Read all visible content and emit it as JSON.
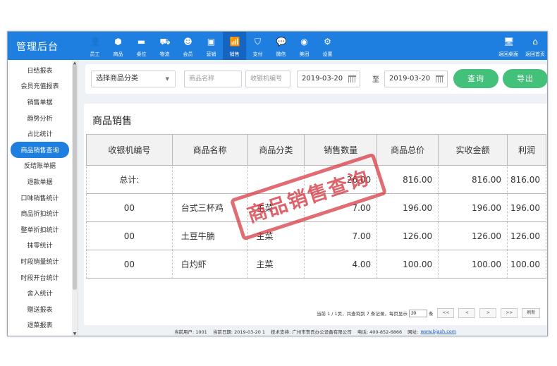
{
  "app": {
    "title": "管理后台"
  },
  "nav": {
    "items": [
      {
        "label": "员工",
        "icon": "user-icon",
        "glyph": "👤"
      },
      {
        "label": "商品",
        "icon": "cube-icon",
        "glyph": "⬢"
      },
      {
        "label": "桌位",
        "icon": "table-icon",
        "glyph": "▬"
      },
      {
        "label": "物流",
        "icon": "truck-icon",
        "glyph": "⛟"
      },
      {
        "label": "会员",
        "icon": "member-icon",
        "glyph": "☻"
      },
      {
        "label": "营销",
        "icon": "marketing-icon",
        "glyph": "▣"
      },
      {
        "label": "销售",
        "icon": "sales-chart-icon",
        "glyph": "📶"
      },
      {
        "label": "支付",
        "icon": "shield-pay-icon",
        "glyph": "⛉"
      },
      {
        "label": "微信",
        "icon": "wechat-icon",
        "glyph": "💬"
      },
      {
        "label": "美团",
        "icon": "meituan-icon",
        "glyph": "◉"
      },
      {
        "label": "设置",
        "icon": "gear-icon",
        "glyph": "⚙"
      }
    ],
    "active_index": 6,
    "right": [
      {
        "label": "返回桌面",
        "icon": "monitor-icon",
        "glyph": "🖥"
      },
      {
        "label": "返回首页",
        "icon": "home-icon",
        "glyph": "⌂"
      }
    ]
  },
  "sidebar": {
    "items": [
      "日结报表",
      "会员充值报表",
      "销售单据",
      "趋势分析",
      "占比统计",
      "商品销售查询",
      "反结账单据",
      "退款单据",
      "口味销售统计",
      "商品折扣统计",
      "整单折扣统计",
      "抹零统计",
      "时段销量统计",
      "时段开台统计",
      "舍入统计",
      "赠送报表",
      "退菜报表"
    ],
    "active_index": 5
  },
  "filter": {
    "category_select": "选择商品分类",
    "product_name_placeholder": "商品名称",
    "cashier_placeholder": "收银机编号",
    "date_from": "2019-03-20",
    "date_to": "2019-03-20",
    "to_label": "至",
    "query_label": "查询",
    "export_label": "导出"
  },
  "report": {
    "title": "商品销售",
    "columns": [
      "收银机编号",
      "商品名称",
      "商品分类",
      "销售数量",
      "商品总价",
      "实收金额",
      "利润"
    ],
    "total": {
      "label": "总计:",
      "qty": "26.00",
      "total_price": "816.00",
      "received": "816.00",
      "profit": "816.00"
    },
    "rows": [
      {
        "cashier": "00",
        "name": "台式三杯鸡",
        "category": "主菜",
        "qty": "7.00",
        "total_price": "196.00",
        "received": "196.00",
        "profit": "196.00"
      },
      {
        "cashier": "00",
        "name": "土豆牛腩",
        "category": "主菜",
        "qty": "7.00",
        "total_price": "126.00",
        "received": "126.00",
        "profit": "126.00"
      },
      {
        "cashier": "00",
        "name": "白灼虾",
        "category": "主菜",
        "qty": "4.00",
        "total_price": "100.00",
        "received": "100.00",
        "profit": "100.00"
      }
    ]
  },
  "pager": {
    "info_prefix": "当前 1 / 1页，共查询到 7 条记录，每页显示",
    "page_size": "20",
    "info_suffix": "条",
    "first": "<<",
    "prev": "<",
    "next": ">",
    "last": ">>",
    "refresh": "刷新"
  },
  "status": {
    "user": "当前用户: 1001",
    "date": "当前日期: 2019-03-20 1",
    "support": "技术支持: 广州市贺氏办公设备有限公司",
    "phone": "电话: 400-852-6866",
    "site_label": "网址:",
    "site_url": "www.bjash.com"
  },
  "stamp": {
    "text": "商品销售查询"
  },
  "colors": {
    "primary": "#1f7fe0",
    "button": "#43c07a",
    "stamp": "#d63c46"
  }
}
